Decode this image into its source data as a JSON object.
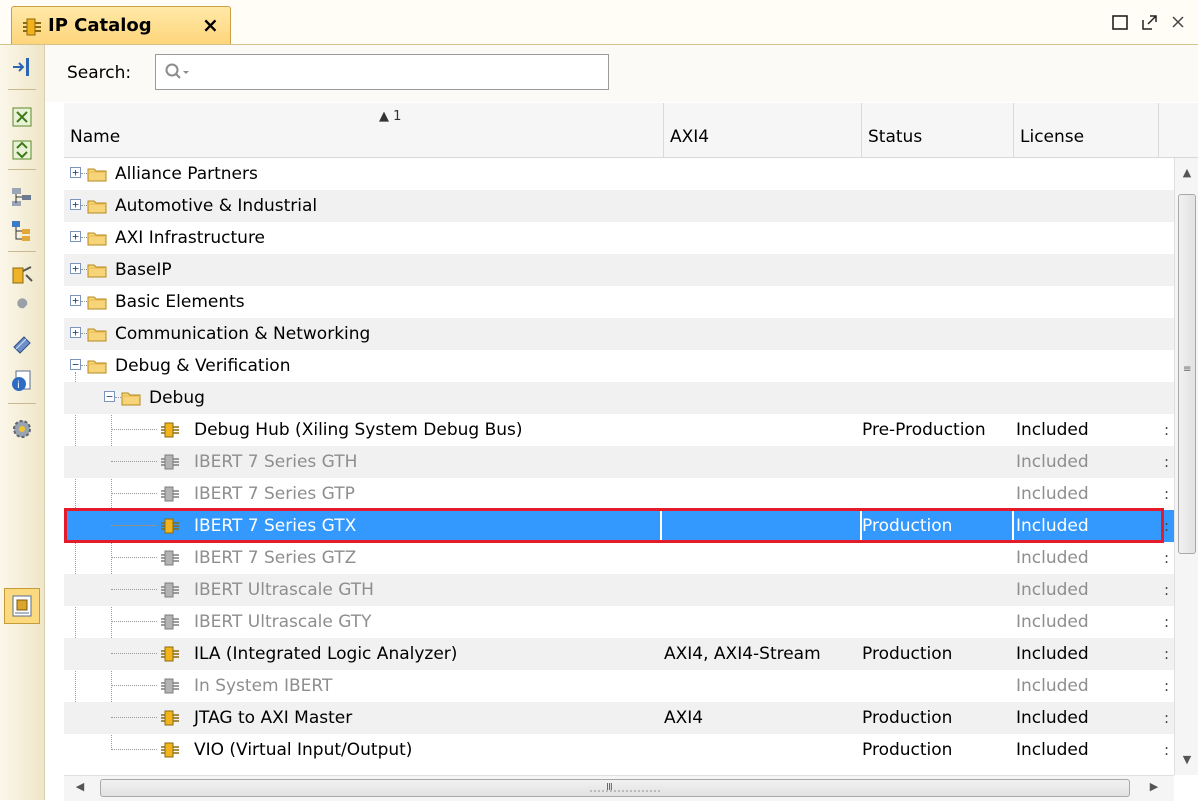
{
  "tab": {
    "title": "IP Catalog",
    "close_glyph": "×"
  },
  "window_controls": [
    "maximize-icon",
    "restore-icon",
    "close-icon"
  ],
  "search": {
    "label": "Search:",
    "value": "",
    "icon": "search-icon"
  },
  "columns": {
    "name": "Name",
    "sort_indicator": "1",
    "axi4": "AXI4",
    "status": "Status",
    "license": "License"
  },
  "rows": [
    {
      "type": "folder",
      "level": 0,
      "expanded": false,
      "name": "Alliance Partners"
    },
    {
      "type": "folder",
      "level": 0,
      "expanded": false,
      "name": "Automotive & Industrial"
    },
    {
      "type": "folder",
      "level": 0,
      "expanded": false,
      "name": "AXI Infrastructure"
    },
    {
      "type": "folder",
      "level": 0,
      "expanded": false,
      "name": "BaseIP"
    },
    {
      "type": "folder",
      "level": 0,
      "expanded": false,
      "name": "Basic Elements"
    },
    {
      "type": "folder",
      "level": 0,
      "expanded": false,
      "name": "Communication & Networking"
    },
    {
      "type": "folder",
      "level": 0,
      "expanded": true,
      "name": "Debug & Verification"
    },
    {
      "type": "folder",
      "level": 1,
      "expanded": true,
      "name": "Debug"
    },
    {
      "type": "ip",
      "level": 2,
      "name": "Debug Hub (Xiling System Debug Bus)",
      "axi4": "",
      "status": "Pre-Production",
      "license": "Included",
      "dim": false
    },
    {
      "type": "ip",
      "level": 2,
      "name": "IBERT 7 Series GTH",
      "axi4": "",
      "status": "",
      "license": "Included",
      "dim": true
    },
    {
      "type": "ip",
      "level": 2,
      "name": "IBERT 7 Series GTP",
      "axi4": "",
      "status": "",
      "license": "Included",
      "dim": true
    },
    {
      "type": "ip",
      "level": 2,
      "name": "IBERT 7 Series GTX",
      "axi4": "",
      "status": "Production",
      "license": "Included",
      "dim": false,
      "selected": true
    },
    {
      "type": "ip",
      "level": 2,
      "name": "IBERT 7 Series GTZ",
      "axi4": "",
      "status": "",
      "license": "Included",
      "dim": true
    },
    {
      "type": "ip",
      "level": 2,
      "name": "IBERT Ultrascale GTH",
      "axi4": "",
      "status": "",
      "license": "Included",
      "dim": true
    },
    {
      "type": "ip",
      "level": 2,
      "name": "IBERT Ultrascale GTY",
      "axi4": "",
      "status": "",
      "license": "Included",
      "dim": true
    },
    {
      "type": "ip",
      "level": 2,
      "name": "ILA (Integrated Logic Analyzer)",
      "axi4": "AXI4, AXI4-Stream",
      "status": "Production",
      "license": "Included",
      "dim": false
    },
    {
      "type": "ip",
      "level": 2,
      "name": "In System IBERT",
      "axi4": "",
      "status": "",
      "license": "Included",
      "dim": true
    },
    {
      "type": "ip",
      "level": 2,
      "name": "JTAG to AXI Master",
      "axi4": "AXI4",
      "status": "Production",
      "license": "Included",
      "dim": false
    },
    {
      "type": "ip",
      "level": 2,
      "name": "VIO (Virtual Input/Output)",
      "axi4": "",
      "status": "Production",
      "license": "Included",
      "dim": false
    }
  ],
  "scrollbar": {
    "h_grip": "III",
    "v_grip": "≡"
  },
  "colors": {
    "selection": "#3399ff",
    "highlight_outline": "#e41b2b",
    "tab_bg": "#fed57b"
  }
}
